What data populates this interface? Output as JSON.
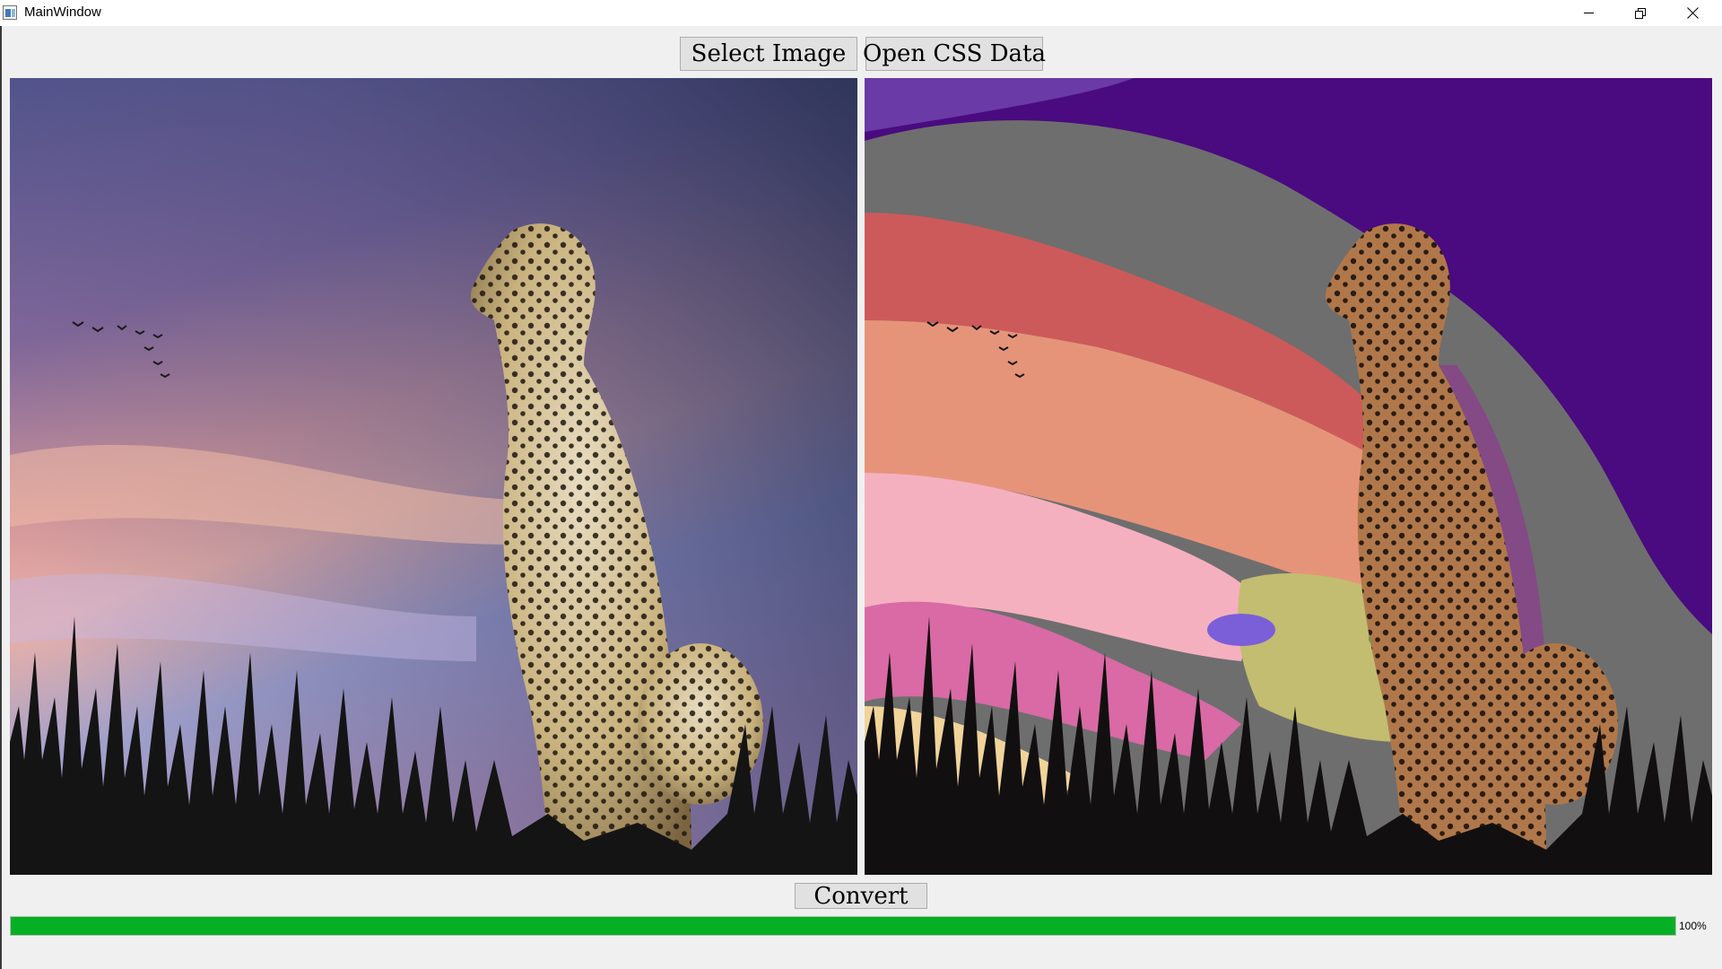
{
  "window": {
    "title": "MainWindow"
  },
  "toolbar": {
    "select_image_label": "Select Image",
    "open_css_label": "Open CSS Data"
  },
  "images": {
    "original_alt": "Original cheetah photo at sunset",
    "converted_alt": "Color-quantized cheetah image"
  },
  "actions": {
    "convert_label": "Convert"
  },
  "progress": {
    "value": 100,
    "text": "100%",
    "fill_color": "#06b025"
  },
  "icons": {
    "app": "app-window-icon",
    "minimize": "minimize-icon",
    "restore": "restore-icon",
    "close": "close-icon"
  }
}
